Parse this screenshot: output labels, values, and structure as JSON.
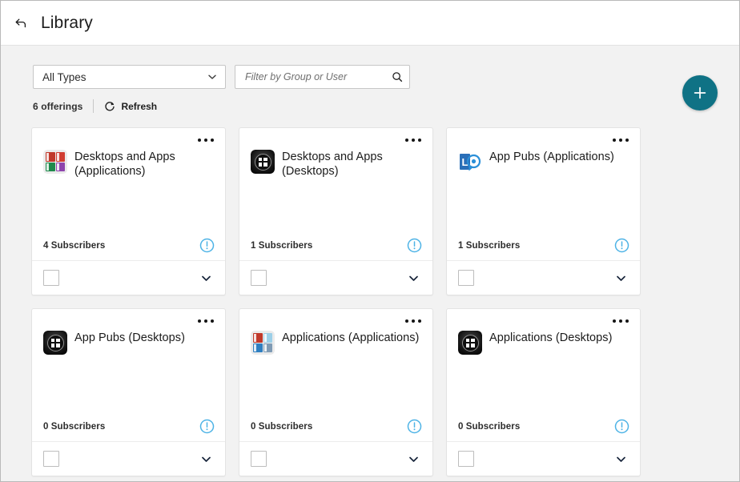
{
  "header": {
    "back_icon": "back-arrow-icon",
    "title": "Library"
  },
  "toolbar": {
    "type_filter": {
      "selected": "All Types",
      "options": [
        "All Types"
      ],
      "chevron_icon": "chevron-down-icon"
    },
    "search": {
      "value": "",
      "placeholder": "Filter by Group or User",
      "icon": "search-icon"
    }
  },
  "count_row": {
    "offerings": "6 offerings",
    "refresh_label": "Refresh",
    "refresh_icon": "refresh-icon"
  },
  "fab": {
    "label": "+",
    "icon": "plus-icon",
    "color": "#0f7285"
  },
  "colors": {
    "accent_teal": "#0f7285",
    "status_blue": "#4db3e6",
    "page_bg": "#f2f2f2",
    "card_bg": "#ffffff",
    "border": "#e3e3e3"
  },
  "cards": [
    {
      "title": "Desktops and Apps (Applications)",
      "subscribers": "4 Subscribers",
      "icon": "office-apps-icon",
      "icon_type": "tiles",
      "tiles": [
        "#c0392b",
        "#d13d32",
        "#1f8a4c",
        "#8e44ad"
      ],
      "status_icon": "alert-info-icon",
      "menu_icon": "kebab-menu-icon",
      "checkbox_checked": false,
      "expand_icon": "chevron-down-icon"
    },
    {
      "title": "Desktops and Apps (Desktops)",
      "subscribers": "1 Subscribers",
      "icon": "windows-desktop-icon",
      "icon_type": "windows",
      "status_icon": "alert-info-icon",
      "menu_icon": "kebab-menu-icon",
      "checkbox_checked": false,
      "expand_icon": "chevron-down-icon"
    },
    {
      "title": "App Pubs (Applications)",
      "subscribers": "1 Subscribers",
      "icon": "lync-app-icon",
      "icon_type": "lync",
      "status_icon": "alert-info-icon",
      "menu_icon": "kebab-menu-icon",
      "checkbox_checked": false,
      "expand_icon": "chevron-down-icon"
    },
    {
      "title": "App Pubs (Desktops)",
      "subscribers": "0 Subscribers",
      "icon": "windows-desktop-icon",
      "icon_type": "windows",
      "status_icon": "alert-info-icon",
      "menu_icon": "kebab-menu-icon",
      "checkbox_checked": false,
      "expand_icon": "chevron-down-icon"
    },
    {
      "title": "Applications (Applications)",
      "subscribers": "0 Subscribers",
      "icon": "office-apps-icon",
      "icon_type": "tiles",
      "tiles": [
        "#c0392b",
        "#9ccfe8",
        "#2f7fc1",
        "#7f9bb5"
      ],
      "status_icon": "alert-info-icon",
      "menu_icon": "kebab-menu-icon",
      "checkbox_checked": false,
      "expand_icon": "chevron-down-icon"
    },
    {
      "title": "Applications (Desktops)",
      "subscribers": "0 Subscribers",
      "icon": "windows-desktop-icon",
      "icon_type": "windows",
      "status_icon": "alert-info-icon",
      "menu_icon": "kebab-menu-icon",
      "checkbox_checked": false,
      "expand_icon": "chevron-down-icon"
    }
  ]
}
